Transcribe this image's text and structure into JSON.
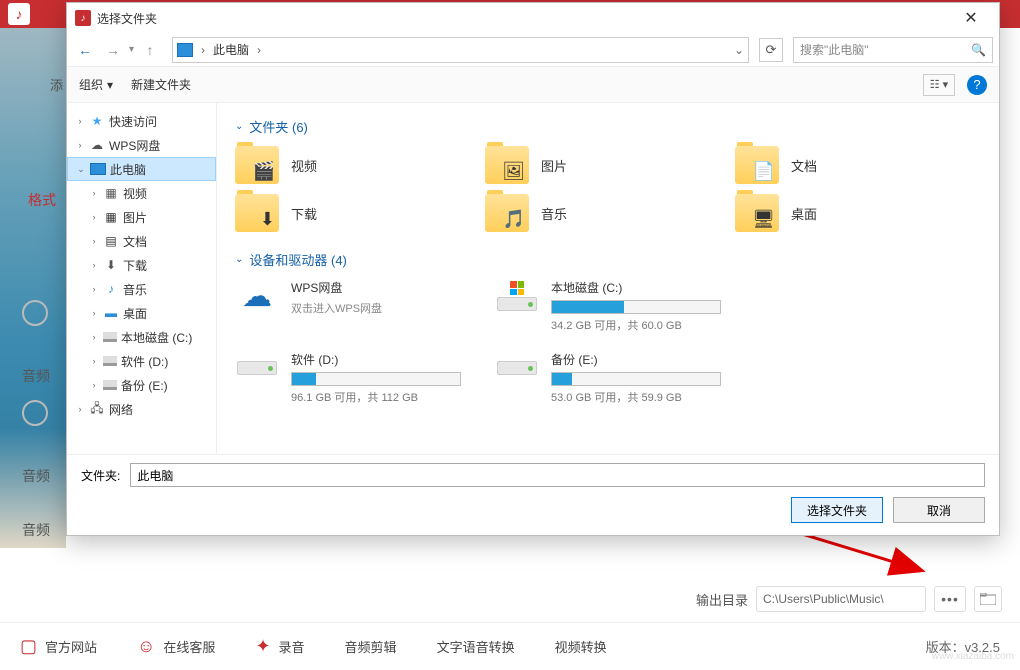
{
  "bg": {
    "add_tab": "添",
    "format_label": "格式",
    "audio_label": "音频",
    "output_label": "输出目录",
    "output_path": "C:\\Users\\Public\\Music\\",
    "browse_dots": "•••",
    "footer": {
      "site": "官方网站",
      "support": "在线客服",
      "record": "录音",
      "cut": "音频剪辑",
      "tts": "文字语音转换",
      "video": "视频转换",
      "version": "版本：v3.2.5"
    },
    "watermark": "www.xiazaiba.com"
  },
  "dlg": {
    "title": "选择文件夹",
    "crumb": "此电脑",
    "search_placeholder": "搜索\"此电脑\"",
    "organize": "组织",
    "new_folder": "新建文件夹",
    "folder_label": "文件夹:",
    "folder_value": "此电脑",
    "btn_select": "选择文件夹",
    "btn_cancel": "取消",
    "group_folders": "文件夹 (6)",
    "group_drives": "设备和驱动器 (4)",
    "tree": {
      "quick": "快速访问",
      "wps": "WPS网盘",
      "pc": "此电脑",
      "videos": "视频",
      "pictures": "图片",
      "documents": "文档",
      "downloads": "下载",
      "music": "音乐",
      "desktop": "桌面",
      "drive_c": "本地磁盘 (C:)",
      "drive_d": "软件 (D:)",
      "drive_e": "备份 (E:)",
      "network": "网络"
    },
    "folders": [
      {
        "name": "视频",
        "overlay": "🎬"
      },
      {
        "name": "图片",
        "overlay": "🖼"
      },
      {
        "name": "文档",
        "overlay": "📄"
      },
      {
        "name": "下载",
        "overlay": "⬇"
      },
      {
        "name": "音乐",
        "overlay": "🎵"
      },
      {
        "name": "桌面",
        "overlay": "🖥"
      }
    ],
    "drives": {
      "wps_name": "WPS网盘",
      "wps_sub": "双击进入WPS网盘",
      "c_name": "本地磁盘 (C:)",
      "c_stats": "34.2 GB 可用，共 60.0 GB",
      "c_pct": 43,
      "d_name": "软件 (D:)",
      "d_stats": "96.1 GB 可用，共 112 GB",
      "d_pct": 14,
      "e_name": "备份 (E:)",
      "e_stats": "53.0 GB 可用，共 59.9 GB",
      "e_pct": 12
    }
  }
}
